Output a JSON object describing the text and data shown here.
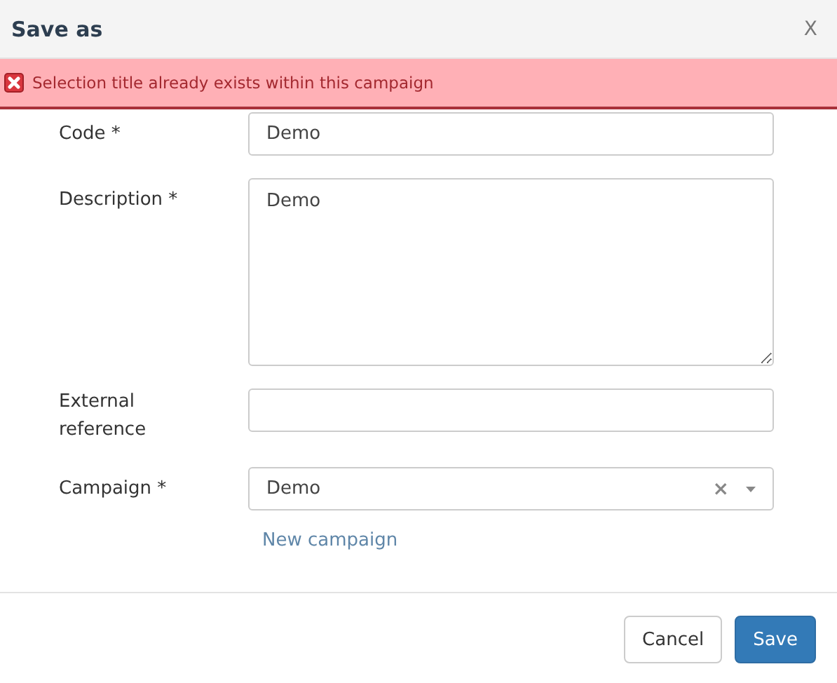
{
  "dialog": {
    "title": "Save as",
    "close": "X"
  },
  "error": {
    "message": "Selection title already exists within this campaign"
  },
  "fields": [
    {
      "kind": "input",
      "label": "Code *",
      "value": "Demo"
    },
    {
      "kind": "textarea",
      "label": "Description *",
      "value": "Demo"
    },
    {
      "kind": "input",
      "label": "External reference"
    },
    {
      "kind": "select",
      "label": "Campaign *",
      "value": "Demo",
      "clear": "×",
      "link": "New campaign"
    }
  ],
  "buttons": [
    {
      "label": "Cancel",
      "kind": "default"
    },
    {
      "label": "Save",
      "kind": "primary"
    }
  ]
}
